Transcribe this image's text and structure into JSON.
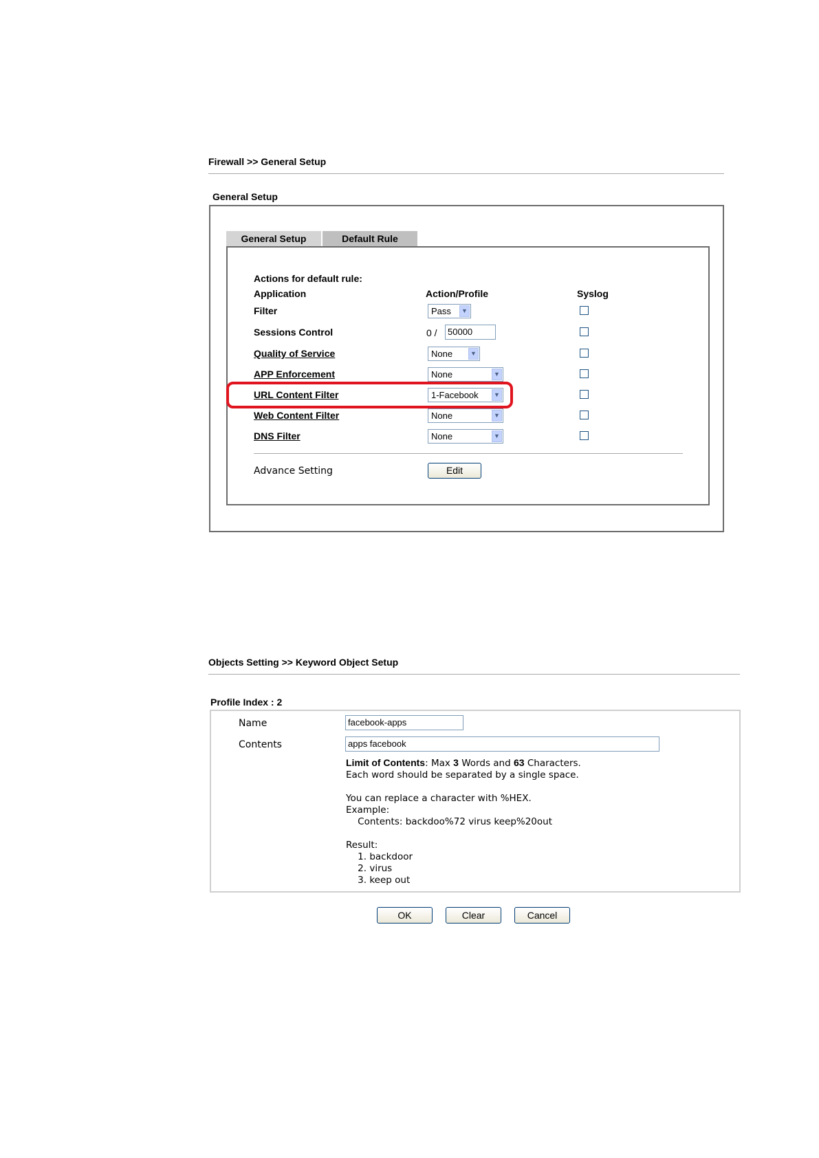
{
  "firewall": {
    "breadcrumb": "Firewall >> General Setup",
    "section_title": "General Setup",
    "tabs": [
      {
        "label": "General Setup"
      },
      {
        "label": "Default Rule"
      }
    ],
    "heading": "Actions for default rule:",
    "col_application": "Application",
    "col_action": "Action/Profile",
    "col_syslog": "Syslog",
    "rows": [
      {
        "label": "Filter",
        "value": "Pass"
      },
      {
        "label": "Sessions Control",
        "prefix": "0 /",
        "value": "50000"
      },
      {
        "label": "Quality of Service",
        "value": "None"
      },
      {
        "label": "APP Enforcement",
        "value": "None"
      },
      {
        "label": "URL Content Filter",
        "value": "1-Facebook"
      },
      {
        "label": "Web Content Filter",
        "value": "None"
      },
      {
        "label": "DNS Filter",
        "value": "None"
      }
    ],
    "advance_label": "Advance Setting",
    "edit_label": "Edit"
  },
  "keyword": {
    "breadcrumb": "Objects Setting >> Keyword Object Setup",
    "profile_index": "Profile Index : 2",
    "name_label": "Name",
    "name_value": "facebook-apps",
    "contents_label": "Contents",
    "contents_value": "apps facebook",
    "limit_bold": "Limit of Contents",
    "limit_rest_1": ": Max ",
    "limit_words": "3",
    "limit_rest_2": " Words and ",
    "limit_chars": "63",
    "limit_rest_3": " Characters.",
    "separator_line": "Each word should be separated by a single space.",
    "hex_line": "You can replace a character with %HEX.",
    "example_label": "Example:",
    "example_line": "    Contents: backdoo%72 virus keep%20out",
    "result_label": "Result:",
    "results": [
      "    1. backdoor",
      "    2. virus",
      "    3. keep out"
    ],
    "ok_label": "OK",
    "clear_label": "Clear",
    "cancel_label": "Cancel"
  },
  "colors": {
    "highlight": "#e0141e",
    "tab_inactive": "#d4d4d4",
    "tab_active": "#bfbfbf",
    "field_border": "#7f9db9"
  }
}
